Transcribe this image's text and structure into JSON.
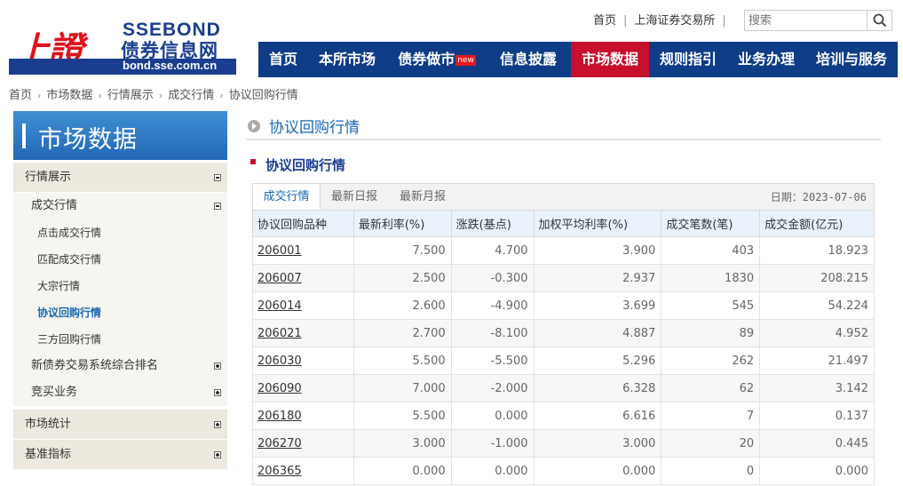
{
  "logo": {
    "hanzi": "上證",
    "en": "SSEBOND",
    "cn": "债券信息网",
    "domain": "bond.sse.com.cn"
  },
  "toplinks": {
    "home": "首页",
    "sse": "上海证券交易所"
  },
  "search": {
    "placeholder": "搜索",
    "icon": "search-icon"
  },
  "nav": [
    {
      "label": "首页"
    },
    {
      "label": "本所市场"
    },
    {
      "label": "债券做市",
      "badge": "new"
    },
    {
      "label": "信息披露"
    },
    {
      "label": "市场数据",
      "active": true
    },
    {
      "label": "规则指引"
    },
    {
      "label": "业务办理"
    },
    {
      "label": "培训与服务"
    }
  ],
  "breadcrumb": [
    "首页",
    "市场数据",
    "行情展示",
    "成交行情",
    "协议回购行情"
  ],
  "sidebar": {
    "title": "市场数据",
    "hangqing": "行情展示",
    "chengjiao": "成交行情",
    "items": [
      "点击成交行情",
      "匹配成交行情",
      "大宗行情",
      "协议回购行情",
      "三方回购行情"
    ],
    "xinzhaiquan": "新债券交易系统综合排名",
    "jingmai": "竞买业务",
    "tongji": "市场统计",
    "jizhun": "基准指标"
  },
  "page_title": "协议回购行情",
  "section_title": "协议回购行情",
  "tabs": [
    "成交行情",
    "最新日报",
    "最新月报"
  ],
  "date_label": "日期：2023-07-06",
  "table": {
    "headers": [
      "协议回购品种",
      "最新利率(%)",
      "涨跌(基点)",
      "加权平均利率(%)",
      "成交笔数(笔)",
      "成交金额(亿元)"
    ],
    "rows": [
      [
        "206001",
        "7.500",
        "4.700",
        "3.900",
        "403",
        "18.923"
      ],
      [
        "206007",
        "2.500",
        "-0.300",
        "2.937",
        "1830",
        "208.215"
      ],
      [
        "206014",
        "2.600",
        "-4.900",
        "3.699",
        "545",
        "54.224"
      ],
      [
        "206021",
        "2.700",
        "-8.100",
        "4.887",
        "89",
        "4.952"
      ],
      [
        "206030",
        "5.500",
        "-5.500",
        "5.296",
        "262",
        "21.497"
      ],
      [
        "206090",
        "7.000",
        "-2.000",
        "6.328",
        "62",
        "3.142"
      ],
      [
        "206180",
        "5.500",
        "0.000",
        "6.616",
        "7",
        "0.137"
      ],
      [
        "206270",
        "3.000",
        "-1.000",
        "3.000",
        "20",
        "0.445"
      ],
      [
        "206365",
        "0.000",
        "0.000",
        "0.000",
        "0",
        "0.000"
      ]
    ]
  },
  "colors": {
    "nav_bg": "#0f3c86",
    "nav_active": "#c8102e",
    "link_blue": "#1768b4",
    "sidebar_title": "#2468b6"
  }
}
